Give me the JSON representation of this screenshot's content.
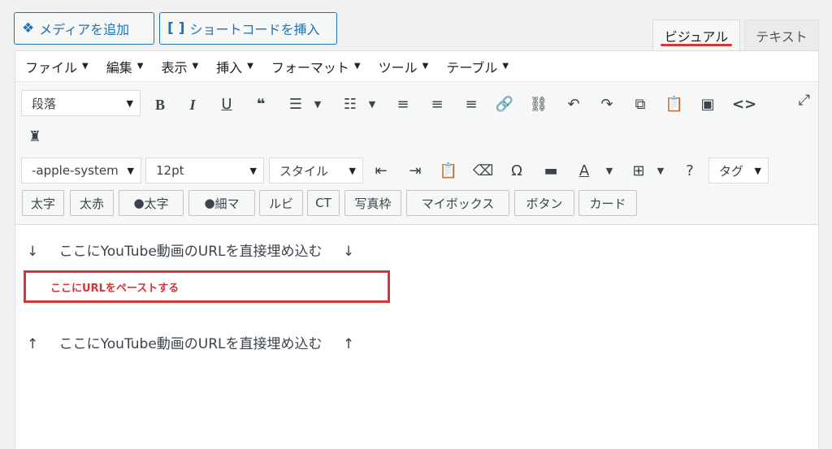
{
  "top_buttons": {
    "media_icon": "media-icon",
    "media_label": "メディアを追加",
    "shortcode_icon": "shortcode-brackets-icon",
    "shortcode_label": "ショートコードを挿入"
  },
  "tabs": {
    "visual": "ビジュアル",
    "text": "テキスト",
    "active": "visual",
    "active_underline_color": "#d63638"
  },
  "menubar": [
    {
      "label": "ファイル"
    },
    {
      "label": "編集"
    },
    {
      "label": "表示"
    },
    {
      "label": "挿入"
    },
    {
      "label": "フォーマット"
    },
    {
      "label": "ツール"
    },
    {
      "label": "テーブル"
    }
  ],
  "toolbar1": {
    "format_select": "段落",
    "icons": [
      "bold-icon",
      "italic-icon",
      "underline-icon",
      "blockquote-icon",
      "bullet-list-icon",
      "numbered-list-icon",
      "align-left-icon",
      "align-center-icon",
      "align-right-icon",
      "link-icon",
      "unlink-icon",
      "undo-icon",
      "redo-icon",
      "copy-icon",
      "paste-icon",
      "image-icon",
      "code-icon",
      "fullscreen-icon",
      "admin-icon"
    ]
  },
  "toolbar2": {
    "font_family": "-apple-system",
    "font_size": "12pt",
    "style_select": "スタイル",
    "tag_select": "タグ"
  },
  "toolbar3": {
    "buttons": [
      "太字",
      "太赤",
      "太字",
      "細マ",
      "ルビ",
      "CT",
      "写真枠",
      "マイボックス",
      "ボタン",
      "カード"
    ]
  },
  "content": {
    "line1_arrow": "↓",
    "line1_text": "ここにYouTube動画のURLを直接埋め込む",
    "paste_hint": "ここにURLをペーストする",
    "line2_arrow": "↑",
    "line2_text": "ここにYouTube動画のURLを直接埋め込む",
    "hint_color": "#d63638"
  }
}
